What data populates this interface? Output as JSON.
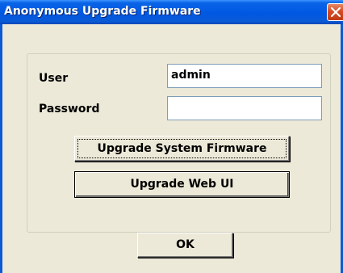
{
  "window": {
    "title": "Anonymous Upgrade Firmware"
  },
  "form": {
    "user_label": "User",
    "user_value": "admin",
    "password_label": "Password",
    "password_value": ""
  },
  "buttons": {
    "upgrade_system_firmware": "Upgrade System Firmware",
    "upgrade_web_ui": "Upgrade Web UI",
    "ok": "OK"
  },
  "icons": {
    "close": "close-icon"
  },
  "colors": {
    "titlebar": "#0058e2",
    "close_button": "#d84a22",
    "dialog_background": "#ece9d8"
  }
}
